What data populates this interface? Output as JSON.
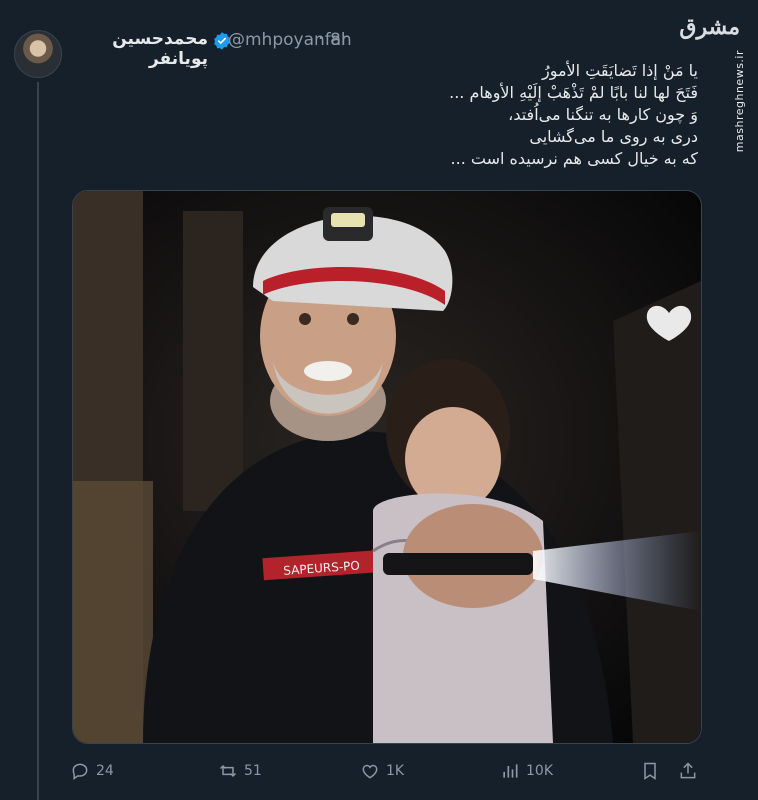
{
  "tweet": {
    "author_name": "محمدحسین پویانفر",
    "handle": "@mhpoyanfar",
    "time": "8h",
    "text_lines": [
      "یا مَنْ إذا تَضایَقَتِ الأمورُ",
      "فَتَحَ لها لنا بابًا لمْ تَذْهَبْ إلَیْهِ الأوهام ...",
      "وَ چون کارها به تنگنا می‌اُفتد،",
      "دری به روی ما می‌گشایی",
      "که به خیال کسی هم نرسیده است ..."
    ],
    "media": {
      "helmet_text": "SAPEURS-PO"
    },
    "actions": {
      "replies": "24",
      "retweets": "51",
      "likes": "1K",
      "views": "10K"
    }
  },
  "watermark": {
    "logo": "مشرق",
    "site": "mashreghnews.ir"
  },
  "colors": {
    "background": "#15202b",
    "text": "#e7e9ea",
    "secondary": "#8b98a5",
    "verified": "#1d9bf0",
    "border": "#38444d"
  },
  "icons": [
    "reply-icon",
    "retweet-icon",
    "like-icon",
    "views-icon",
    "bookmark-icon",
    "share-icon",
    "verified-icon"
  ]
}
